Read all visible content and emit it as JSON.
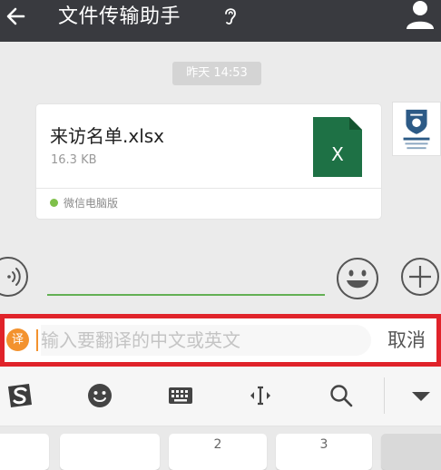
{
  "header": {
    "title": "文件传输助手",
    "back_icon": "arrow-left-icon",
    "ear_icon": "ear-icon",
    "profile_icon": "person-icon",
    "bg_color": "#393a3f"
  },
  "chat": {
    "timestamp": "昨天 14:53",
    "file_message": {
      "file_name": "来访名单.xlsx",
      "file_size": "16.3 KB",
      "file_icon_letter": "X",
      "file_icon_color": "#1e7145",
      "source_label": "微信电脑版"
    }
  },
  "input_bar": {
    "voice_icon": "voice-icon",
    "emoji_icon": "emoji-icon",
    "plus_icon": "plus-icon",
    "accent_color": "#63b054"
  },
  "translate": {
    "badge": "译",
    "placeholder": "输入要翻译的中文或英文",
    "cancel_label": "取消",
    "highlight_color": "#e0232a"
  },
  "ime_toolbar": {
    "icons": [
      "sogou-logo-icon",
      "emoji-face-icon",
      "keyboard-icon",
      "cursor-move-icon",
      "search-icon",
      "collapse-arrow-icon"
    ]
  },
  "keyboard": {
    "keys": [
      "",
      "2",
      "3"
    ]
  }
}
